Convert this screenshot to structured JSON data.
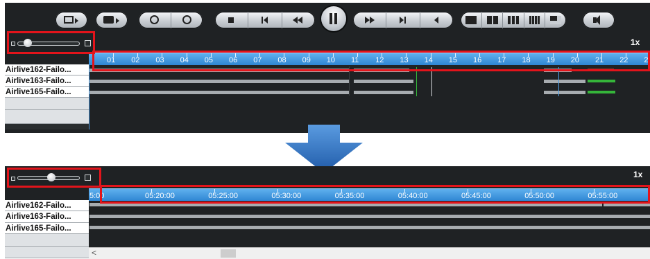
{
  "top": {
    "speed": "1x",
    "ruler_ticks": [
      "01",
      "02",
      "03",
      "04",
      "05",
      "06",
      "07",
      "08",
      "09",
      "10",
      "11",
      "12",
      "13",
      "14",
      "15",
      "16",
      "17",
      "18",
      "19",
      "20",
      "21",
      "22",
      "23"
    ],
    "channels": [
      "Airlive162-Failo...",
      "Airlive163-Failo...",
      "Airlive165-Failo..."
    ],
    "zoom_level": 0.1
  },
  "bottom": {
    "speed": "1x",
    "ruler_first_label": "5:00",
    "ruler_ticks": [
      "05:20:00",
      "05:25:00",
      "05:30:00",
      "05:35:00",
      "05:40:00",
      "05:45:00",
      "05:50:00",
      "05:55:00",
      "06"
    ],
    "channels": [
      "Airlive162-Failo...",
      "Airlive163-Failo...",
      "Airlive165-Failo..."
    ],
    "zoom_level": 0.55,
    "scroll_left_glyph": "<"
  },
  "toolbar": {
    "icons": [
      "layout-export-icon",
      "snapshot-export-icon",
      "zoom-out-icon",
      "zoom-in-icon",
      "stop-icon",
      "step-back-icon",
      "rewind-icon",
      "pause-icon",
      "fast-forward-icon",
      "step-forward-icon",
      "reverse-play-icon",
      "view-1-icon",
      "view-4-icon",
      "view-9-icon",
      "view-16-icon",
      "view-pip-icon",
      "volume-icon"
    ]
  },
  "colors": {
    "panel": "#1f2224",
    "ruler": "#3a95de",
    "highlight": "#e3141b",
    "arrow": "#2f6fc0",
    "recording": "#35b53a"
  }
}
